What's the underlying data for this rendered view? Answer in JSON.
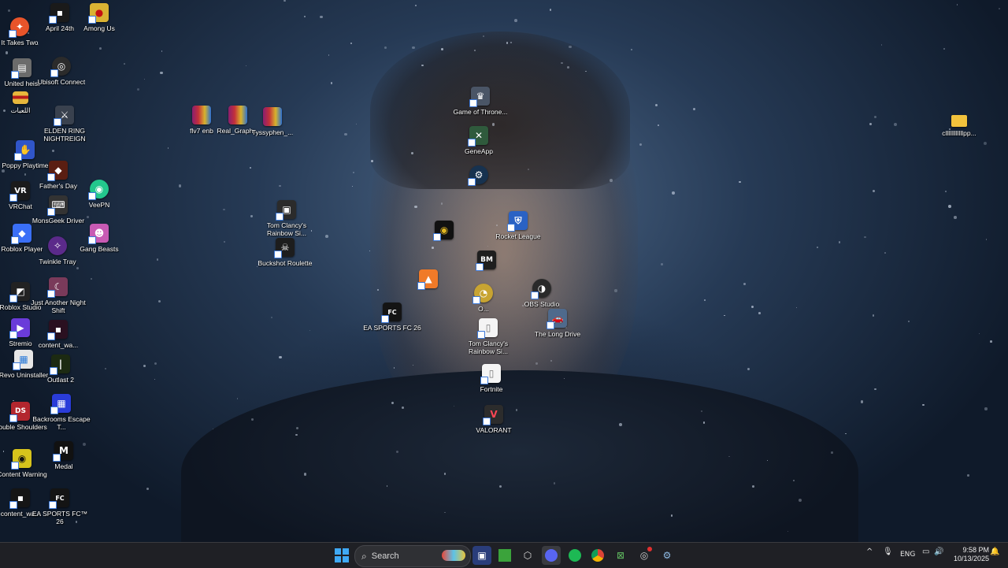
{
  "desktop_icons": {
    "it_takes_two": "It Takes Two",
    "april_24th": "April 24th",
    "among_us": "Among Us",
    "united_heist": "United heist",
    "ubisoft_connect": "Ubisoft Connect",
    "arabic_folder": "اللعبات",
    "elden_ring": "ELDEN RING NIGHTREIGN",
    "poppy_playtime": "Poppy Playtime",
    "fathers_day": "Father's Day",
    "vrchat": "VRChat",
    "veepn": "VeePN",
    "monsgeek": "MonsGeek Driver",
    "roblox_player": "Roblox Player",
    "twinkle_tray": "Twinkle Tray",
    "gang_beasts": "Gang Beasts",
    "roblox_studio": "Roblox Studio",
    "just_another_night_shift": "Just Another Night Shift",
    "stremio": "Stremio",
    "content_wa_1": "content_wa...",
    "revo_uninstaller": "Revo Uninstaller",
    "outlast_2": "Outlast 2",
    "double_shoulders": "Double Shoulders",
    "backrooms": "Backrooms Escape T...",
    "content_warning": "Content Warning",
    "medal": "Medal",
    "content_wa_2": "content_wa...",
    "ea_sports_fc_left": "EA SPORTS FC™ 26",
    "flv7_enb": "flv7 enb",
    "real_graph": "Real_Graph...",
    "tyssyphen": "Tyssyphen_...",
    "tom_clancy_1": "Tom Clancy's Rainbow Si...",
    "buckshot_roulette": "Buckshot Roulette",
    "game_of_thrones": "Game of Throne...",
    "game_app": "GeneApp",
    "steam_center": "",
    "unknown_yellow": "",
    "rocket_league": "Rocket League",
    "bm_icon": "",
    "orange_icon": "",
    "ea_sports_fc_center": "EA SPORTS FC 26",
    "overwolf": "O...",
    "obs_studio": "OBS Studio",
    "tom_clancy_2": "Tom Clancy's Rainbow Si...",
    "the_long_drive": "The Long Drive",
    "fortnite": "Fortnite",
    "valorant": "VALORANT",
    "folder_right": "cllllllllllllpp..."
  },
  "taskbar": {
    "search_placeholder": "Search",
    "language": "ENG",
    "time": "9:58 PM",
    "date": "10/13/2025",
    "start_glyph": "⊞",
    "chevron_glyph": "^",
    "mic_glyph": "🎙",
    "volume_glyph": "🔊",
    "network_glyph": "▭",
    "bell_glyph": "🔔"
  }
}
